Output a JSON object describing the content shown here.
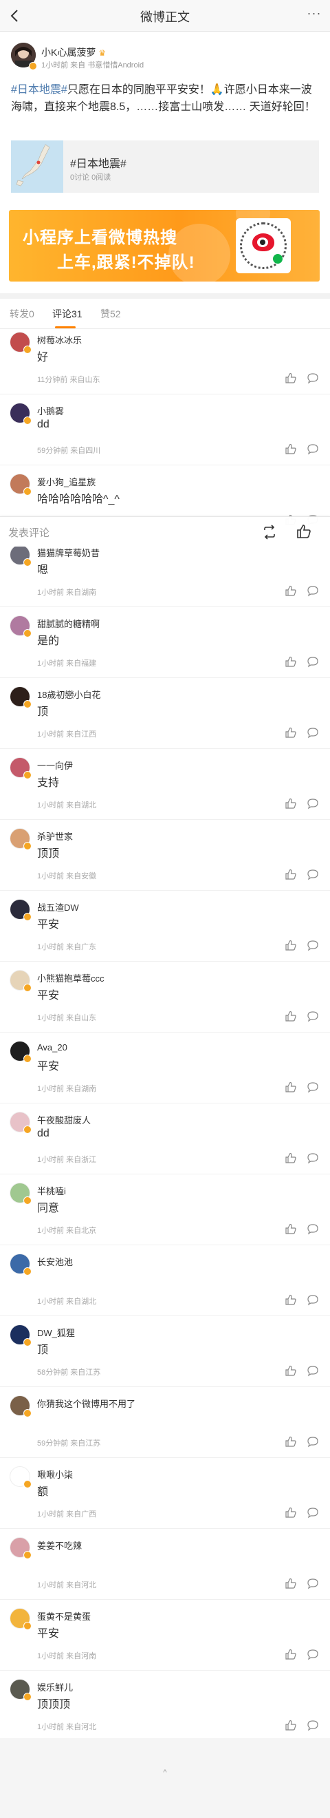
{
  "header": {
    "title": "微博正文",
    "more": "···"
  },
  "post": {
    "author": "小K心属菠萝",
    "meta": "1小时前  来自 书意惜惜Android",
    "hashtag": "#日本地震#",
    "text_line": "只愿在日本的同胞平平安安！🙏许愿小日本来一波海啸，直接来个地震8.5，……接富士山喷发…… 天道好轮回！",
    "topic_card": {
      "title": "#日本地震#",
      "stats": "0讨论 0阅读"
    }
  },
  "banner": {
    "line1": "小程序上看微博热搜",
    "line2": "上车,跟紧!不掉队!"
  },
  "tabs": [
    {
      "label": "转发0"
    },
    {
      "label": "评论31"
    },
    {
      "label": "赞52"
    }
  ],
  "reply_bar": {
    "placeholder": "发表评论"
  },
  "comments": [
    {
      "name": "树莓冰冰乐",
      "text": "好",
      "meta": "11分钟前 来自山东"
    },
    {
      "name": "小鹅雾",
      "text": "dd",
      "meta": "59分钟前 来自四川"
    },
    {
      "name": "爱小狗_追星族",
      "text": "哈哈哈哈哈哈^_^",
      "meta": ""
    },
    {
      "name": "猫猫牌草莓奶昔",
      "text": "嗯",
      "meta": "1小时前 来自湖南"
    },
    {
      "name": "甜腻腻的糖精啊",
      "text": "是的",
      "meta": "1小时前 来自福建"
    },
    {
      "name": "18歲初戀小白花",
      "text": "顶",
      "meta": "1小时前 来自江西"
    },
    {
      "name": "一一向伊",
      "text": "支持",
      "meta": "1小时前 来自湖北"
    },
    {
      "name": "杀驴世家",
      "text": "顶顶",
      "meta": "1小时前 来自安徽"
    },
    {
      "name": "战五渣DW",
      "text": "平安",
      "meta": "1小时前 来自广东"
    },
    {
      "name": "小熊猫抱草莓ccc",
      "text": "平安",
      "meta": "1小时前 来自山东"
    },
    {
      "name": "Ava_20",
      "text": "平安",
      "meta": "1小时前 来自湖南"
    },
    {
      "name": "午夜酸甜废人",
      "text": "dd",
      "meta": "1小时前 来自浙江"
    },
    {
      "name": "半桃嗑i",
      "text": "同意",
      "meta": "1小时前 来自北京"
    },
    {
      "name": "长安池池",
      "text": "",
      "meta": "1小时前 来自湖北"
    },
    {
      "name": "DW_狐狸",
      "text": "顶",
      "meta": "58分钟前 来自江苏"
    },
    {
      "name": "你猜我这个微博用不用了",
      "text": "",
      "meta": "59分钟前 来自江苏"
    },
    {
      "name": "啾啾小柒",
      "text": "额",
      "meta": "1小时前 来自广西"
    },
    {
      "name": "姜姜不吃辣",
      "text": "",
      "meta": "1小时前 来自河北"
    },
    {
      "name": "蛋黄不是黄蛋",
      "text": "平安",
      "meta": "1小时前 来自河南"
    },
    {
      "name": "娱乐鲜儿",
      "text": "顶顶顶",
      "meta": "1小时前 来自河北"
    }
  ],
  "footer": {
    "endmark": "^"
  },
  "colors": {
    "accent": "#ff8200",
    "link": "#507daf",
    "vip": "#f5a623"
  }
}
